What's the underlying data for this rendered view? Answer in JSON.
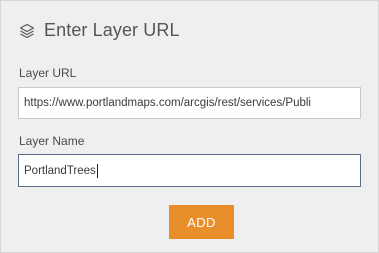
{
  "dialog": {
    "title": "Enter Layer URL",
    "title_icon": "layers-icon"
  },
  "fields": {
    "url": {
      "label": "Layer URL",
      "value": "https://www.portlandmaps.com/arcgis/rest/services/Publi"
    },
    "name": {
      "label": "Layer Name",
      "value": "PortlandTrees"
    }
  },
  "actions": {
    "add_label": "ADD"
  },
  "colors": {
    "accent": "#e88f2c",
    "panel_background": "#efefef",
    "focused_border": "#5c6d8b"
  }
}
